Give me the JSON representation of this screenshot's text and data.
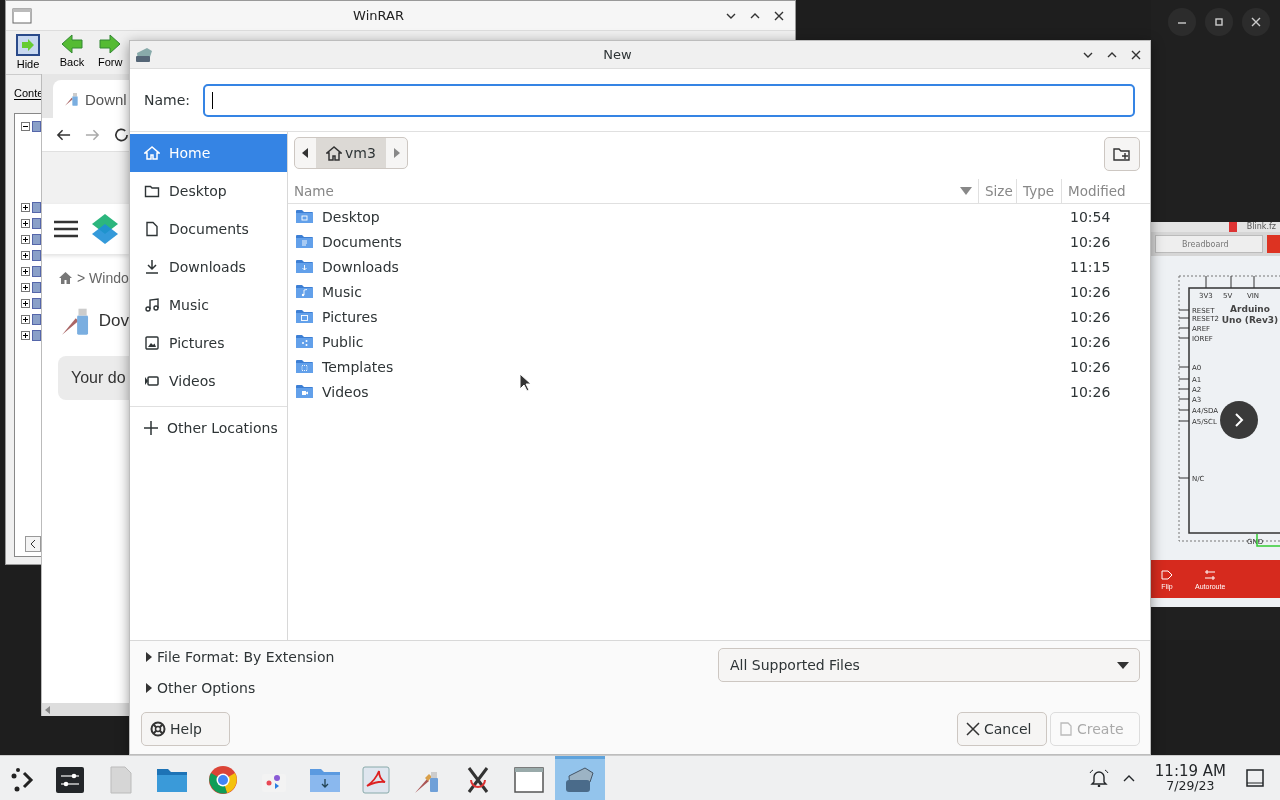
{
  "winrar": {
    "title": "WinRAR",
    "toolbar": [
      {
        "label": "Hide"
      },
      {
        "label": "Back"
      },
      {
        "label": "Forw"
      }
    ],
    "tab": "Conte",
    "tree": [
      {
        "expanded": true
      },
      {
        "expanded": false
      },
      {
        "expanded": false
      },
      {
        "expanded": false
      },
      {
        "expanded": false
      },
      {
        "expanded": false
      },
      {
        "expanded": false
      },
      {
        "expanded": false
      },
      {
        "expanded": false
      },
      {
        "expanded": false
      }
    ]
  },
  "browser": {
    "tab": "Downl",
    "breadcrumb": "> Windo",
    "heading": "Dov",
    "notice": "Your do"
  },
  "fritzing": {
    "file_tab": "Blink.fz",
    "view": "Breadboard",
    "board": "Arduino Uno (Rev3)",
    "pins_top": [
      "3V3",
      "5V",
      "VIN"
    ],
    "pins_left": [
      "RESET",
      "RESET2",
      "AREF",
      "IOREF",
      "A0",
      "A1",
      "A2",
      "A3",
      "A4/SDA",
      "A5/SCL",
      "N/C"
    ],
    "pin_bottom": "GND",
    "tools": [
      {
        "label": "Flip"
      },
      {
        "label": "Autoroute"
      }
    ]
  },
  "dialog": {
    "title": "New",
    "name_label": "Name:",
    "places": [
      {
        "label": "Home",
        "selected": true
      },
      {
        "label": "Desktop",
        "selected": false
      },
      {
        "label": "Documents",
        "selected": false
      },
      {
        "label": "Downloads",
        "selected": false
      },
      {
        "label": "Music",
        "selected": false
      },
      {
        "label": "Pictures",
        "selected": false
      },
      {
        "label": "Videos",
        "selected": false
      }
    ],
    "other_locations": "Other Locations",
    "path": "vm3",
    "columns": [
      "Name",
      "Size",
      "Type",
      "Modified"
    ],
    "files": [
      {
        "name": "Desktop",
        "modified": "10:54"
      },
      {
        "name": "Documents",
        "modified": "10:26"
      },
      {
        "name": "Downloads",
        "modified": "11:15"
      },
      {
        "name": "Music",
        "modified": "10:26"
      },
      {
        "name": "Pictures",
        "modified": "10:26"
      },
      {
        "name": "Public",
        "modified": "10:26"
      },
      {
        "name": "Templates",
        "modified": "10:26"
      },
      {
        "name": "Videos",
        "modified": "10:26"
      }
    ],
    "file_format": "File Format: By Extension",
    "other_options": "Other Options",
    "filter": "All Supported Files",
    "help": "Help",
    "cancel": "Cancel",
    "create": "Create",
    "create_disabled": true
  },
  "taskbar": {
    "apps": [
      {
        "selected": false
      },
      {
        "selected": false
      },
      {
        "selected": false
      },
      {
        "selected": false
      },
      {
        "selected": false
      },
      {
        "selected": false
      },
      {
        "selected": false
      },
      {
        "selected": false
      },
      {
        "selected": false
      },
      {
        "selected": false
      },
      {
        "selected": false
      },
      {
        "selected": true
      }
    ],
    "time": "11:19 AM",
    "date": "7/29/23"
  }
}
